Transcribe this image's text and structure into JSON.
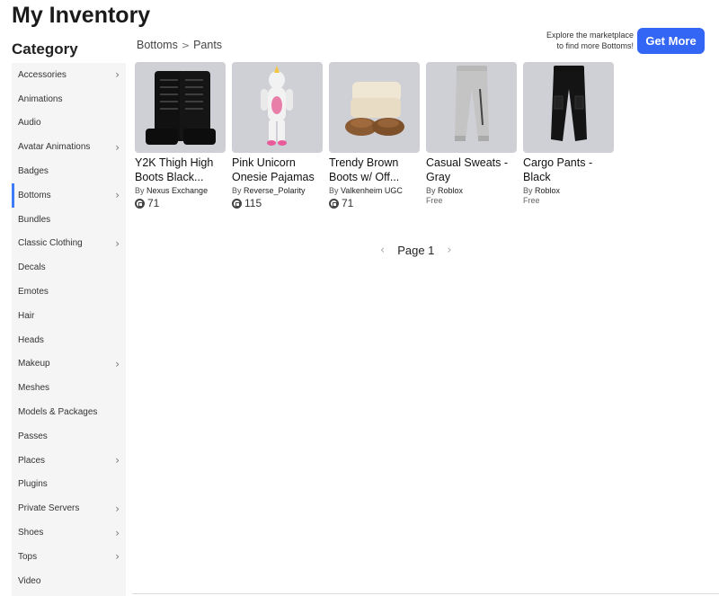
{
  "page": {
    "title": "My Inventory",
    "category_heading": "Category"
  },
  "sidebar": {
    "items": [
      {
        "label": "Accessories",
        "chevron": true
      },
      {
        "label": "Animations",
        "chevron": false
      },
      {
        "label": "Audio",
        "chevron": false
      },
      {
        "label": "Avatar Animations",
        "chevron": true
      },
      {
        "label": "Badges",
        "chevron": false
      },
      {
        "label": "Bottoms",
        "chevron": true,
        "active": true
      },
      {
        "label": "Bundles",
        "chevron": false
      },
      {
        "label": "Classic Clothing",
        "chevron": true
      },
      {
        "label": "Decals",
        "chevron": false
      },
      {
        "label": "Emotes",
        "chevron": false
      },
      {
        "label": "Hair",
        "chevron": false
      },
      {
        "label": "Heads",
        "chevron": false
      },
      {
        "label": "Makeup",
        "chevron": true
      },
      {
        "label": "Meshes",
        "chevron": false
      },
      {
        "label": "Models & Packages",
        "chevron": false
      },
      {
        "label": "Passes",
        "chevron": false
      },
      {
        "label": "Places",
        "chevron": true
      },
      {
        "label": "Plugins",
        "chevron": false
      },
      {
        "label": "Private Servers",
        "chevron": true
      },
      {
        "label": "Shoes",
        "chevron": true
      },
      {
        "label": "Tops",
        "chevron": true
      },
      {
        "label": "Video",
        "chevron": false
      }
    ]
  },
  "breadcrumb": {
    "parent": "Bottoms",
    "separator": ">",
    "current": "Pants"
  },
  "promo": {
    "line1": "Explore the marketplace",
    "line2": "to find more Bottoms!",
    "button": "Get More"
  },
  "items": [
    {
      "name": "Y2K Thigh High Boots Black...",
      "by_prefix": "By",
      "creator": "Nexus Exchange",
      "price": "71",
      "icon": "boots-black-thumbnail"
    },
    {
      "name": "Pink Unicorn Onesie Pajamas",
      "by_prefix": "By",
      "creator": "Reverse_Polarity",
      "price": "115",
      "icon": "unicorn-onesie-thumbnail"
    },
    {
      "name": "Trendy Brown Boots w/ Off...",
      "by_prefix": "By",
      "creator": "Valkenheim UGC",
      "price": "71",
      "icon": "brown-boots-thumbnail"
    },
    {
      "name": "Casual Sweats - Gray",
      "by_prefix": "By",
      "creator": "Roblox",
      "price": "Free",
      "icon": "gray-sweats-thumbnail"
    },
    {
      "name": "Cargo Pants - Black",
      "by_prefix": "By",
      "creator": "Roblox",
      "price": "Free",
      "icon": "black-cargo-thumbnail"
    }
  ],
  "pager": {
    "prev": "‹",
    "label": "Page 1",
    "next": "›"
  },
  "colors": {
    "accent": "#3366f5",
    "active_indicator": "#3d7bf7",
    "thumb_bg": "#cfd0d5"
  }
}
